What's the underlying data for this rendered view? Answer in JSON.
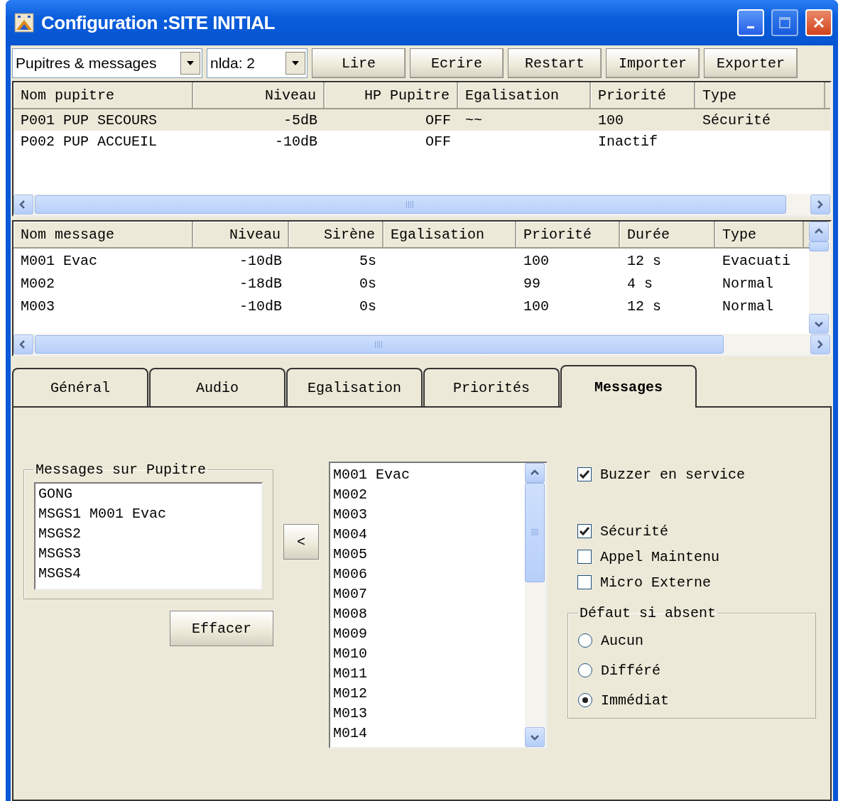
{
  "window": {
    "title": "Configuration :SITE INITIAL"
  },
  "toolbar": {
    "view_select": {
      "value": "Pupitres & messages"
    },
    "nlda_select": {
      "value": "nlda:  2"
    },
    "buttons": [
      "Lire",
      "Ecrire",
      "Restart",
      "Importer",
      "Exporter"
    ]
  },
  "pupitres_table": {
    "columns": [
      "Nom pupitre",
      "Niveau",
      "HP Pupitre",
      "Egalisation",
      "Priorité",
      "Type"
    ],
    "rows": [
      {
        "cells": [
          "P001 PUP SECOURS",
          "-5dB",
          "OFF",
          "~~",
          "100",
          "Sécurité"
        ],
        "selected": true
      },
      {
        "cells": [
          "P002 PUP ACCUEIL",
          "-10dB",
          "OFF",
          "",
          "Inactif",
          ""
        ],
        "selected": false
      }
    ]
  },
  "messages_table": {
    "columns": [
      "Nom message",
      "Niveau",
      "Sirène",
      "Egalisation",
      "Priorité",
      "Durée",
      "Type"
    ],
    "rows": [
      {
        "cells": [
          "M001 Evac",
          "-10dB",
          "5s",
          "",
          "100",
          "12 s",
          "Evacuati"
        ]
      },
      {
        "cells": [
          "M002",
          "-18dB",
          "0s",
          "",
          "99",
          "4 s",
          "Normal"
        ]
      },
      {
        "cells": [
          "M003",
          "-10dB",
          "0s",
          "",
          "100",
          "12 s",
          "Normal"
        ]
      }
    ]
  },
  "tabs": [
    {
      "label": "Général",
      "selected": false
    },
    {
      "label": "Audio",
      "selected": false
    },
    {
      "label": "Egalisation",
      "selected": false
    },
    {
      "label": "Priorités",
      "selected": false
    },
    {
      "label": "Messages",
      "selected": true
    }
  ],
  "messages_panel": {
    "group_title": "Messages sur Pupitre",
    "assigned": [
      "GONG",
      "MSGS1 M001 Evac",
      "MSGS2",
      "MSGS3",
      "MSGS4"
    ],
    "move_button": "<",
    "clear_button": "Effacer",
    "available": [
      "M001 Evac",
      "M002",
      "M003",
      "M004",
      "M005",
      "M006",
      "M007",
      "M008",
      "M009",
      "M010",
      "M011",
      "M012",
      "M013",
      "M014"
    ],
    "buzzer": {
      "label": "Buzzer en service",
      "checked": true
    },
    "options": [
      {
        "label": "Sécurité",
        "checked": true
      },
      {
        "label": "Appel Maintenu",
        "checked": false
      },
      {
        "label": "Micro Externe",
        "checked": false
      }
    ],
    "default_group": {
      "title": "Défaut si absent",
      "options": [
        {
          "label": "Aucun",
          "selected": false
        },
        {
          "label": "Différé",
          "selected": false
        },
        {
          "label": "Immédiat",
          "selected": true
        }
      ]
    }
  }
}
